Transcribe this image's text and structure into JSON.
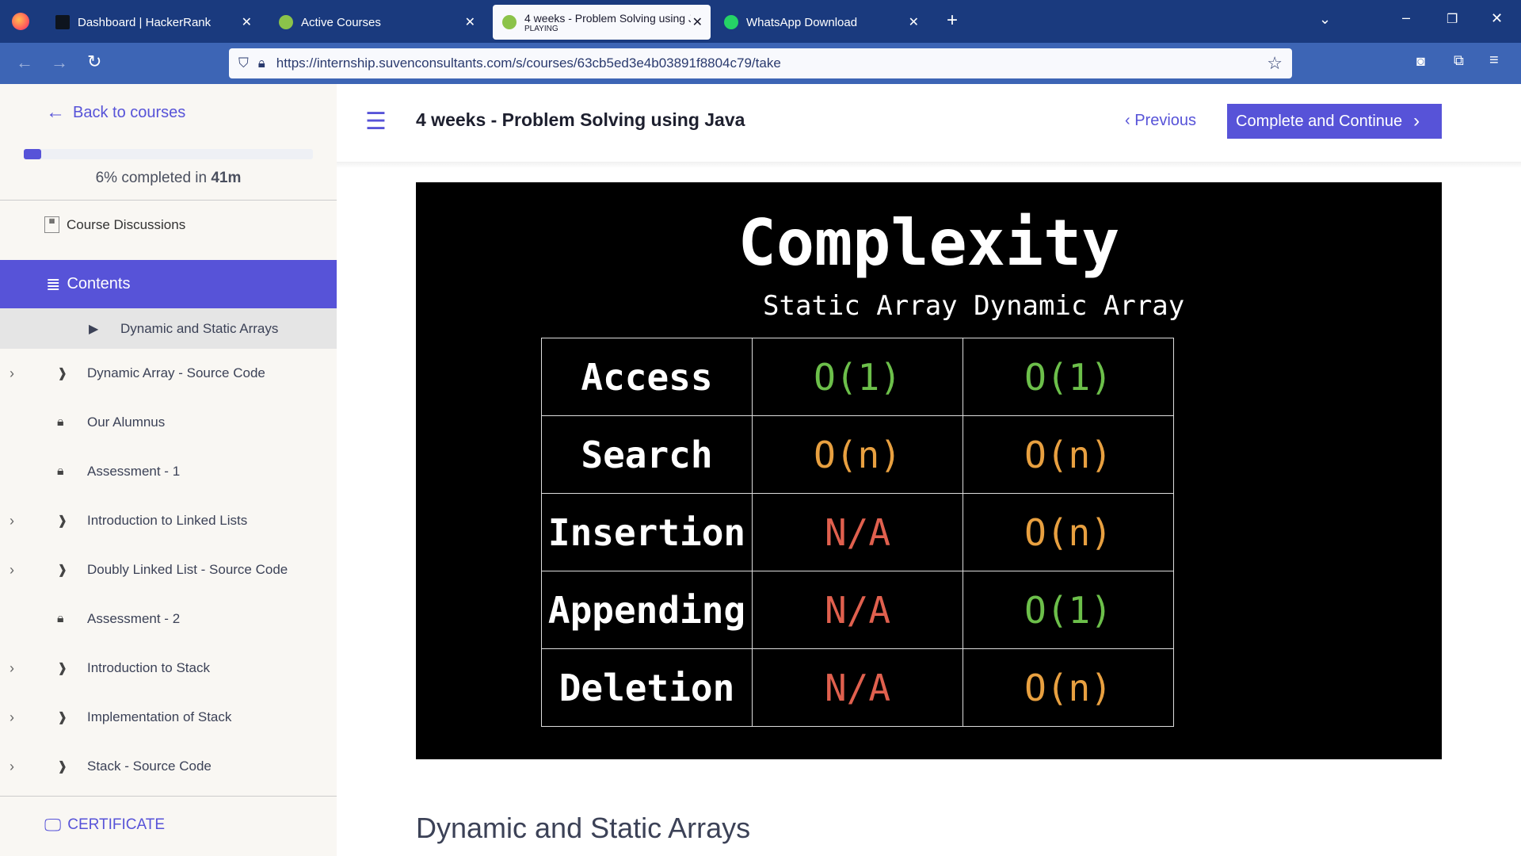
{
  "browser": {
    "tabs": [
      {
        "title": "Dashboard | HackerRank"
      },
      {
        "title": "Active Courses"
      },
      {
        "title": "4 weeks - Problem Solving using Java",
        "sub": "PLAYING"
      },
      {
        "title": "WhatsApp Download"
      }
    ],
    "url": "https://internship.suvenconsultants.com/s/courses/63cb5ed3e4b03891f8804c79/take"
  },
  "sidebar": {
    "back": "Back to courses",
    "progress_percent": 6,
    "progress_text": "6% completed in ",
    "progress_time": "41m",
    "discussions": "Course Discussions",
    "contents": "Contents",
    "current": "Dynamic and Static Arrays",
    "items": [
      {
        "label": "Dynamic Array - Source Code",
        "type": "expand"
      },
      {
        "label": "Our Alumnus",
        "type": "locked"
      },
      {
        "label": "Assessment - 1",
        "type": "locked"
      },
      {
        "label": "Introduction to Linked Lists",
        "type": "expand"
      },
      {
        "label": "Doubly Linked List - Source Code",
        "type": "expand"
      },
      {
        "label": "Assessment - 2",
        "type": "locked"
      },
      {
        "label": "Introduction to Stack",
        "type": "expand"
      },
      {
        "label": "Implementation of Stack",
        "type": "expand"
      },
      {
        "label": "Stack - Source Code",
        "type": "expand"
      }
    ],
    "certificate": "CERTIFICATE"
  },
  "header": {
    "title": "4 weeks - Problem Solving using Java",
    "previous": "Previous",
    "complete": "Complete and Continue"
  },
  "slide": {
    "title": "Complexity",
    "col1": "Static Array",
    "col2": "Dynamic Array",
    "rows": [
      [
        "Access",
        "O(1)",
        "O(1)"
      ],
      [
        "Search",
        "O(n)",
        "O(n)"
      ],
      [
        "Insertion",
        "N/A",
        "O(n)"
      ],
      [
        "Appending",
        "N/A",
        "O(1)"
      ],
      [
        "Deletion",
        "N/A",
        "O(n)"
      ]
    ],
    "colors": {
      "O(1)": "#6cbf4a",
      "O(n)": "#e8a040",
      "N/A": "#e0604e"
    }
  },
  "lesson_heading": "Dynamic and Static Arrays",
  "colors": {
    "accent": "#5753d8"
  }
}
